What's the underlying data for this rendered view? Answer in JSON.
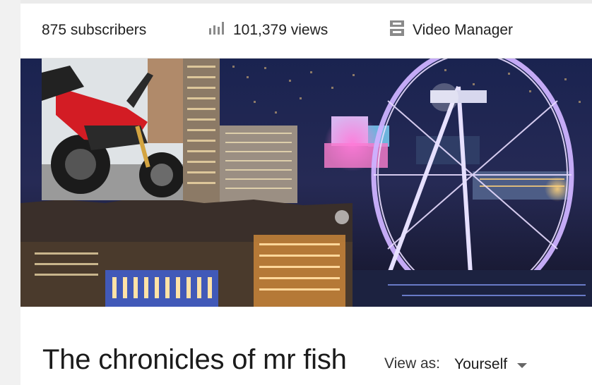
{
  "stats": {
    "subscribers": "875 subscribers",
    "views": "101,379 views",
    "video_manager": "Video Manager",
    "views_icon": "bar-chart-icon",
    "video_manager_icon": "video-manager-icon"
  },
  "banner": {
    "scene": "night-city-ferris-wheel",
    "thumbnail": "red-motorcycle"
  },
  "channel": {
    "title": "The chronicles of mr fish",
    "view_as_label": "View as:",
    "view_as_value": "Yourself"
  },
  "colors": {
    "text": "#222222",
    "icon": "#888888",
    "wheel": "#c9a8ff"
  }
}
